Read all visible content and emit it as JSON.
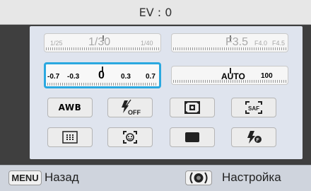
{
  "header": {
    "title": "EV : 0"
  },
  "shutter_scale": {
    "left": "1/25",
    "current": "1/30",
    "right": "1/40"
  },
  "aperture_scale": {
    "current": "F3.5",
    "next1": "F4.0",
    "next2": "F4.5"
  },
  "ev_scale": {
    "values": [
      "-0.7",
      "-0.3",
      "0",
      "0.3",
      "0.7"
    ]
  },
  "iso_scale": {
    "current": "AUTO",
    "next": "100"
  },
  "buttons": {
    "awb": "AWB",
    "flash_off_label": "OFF",
    "smart_af_label": "SAF"
  },
  "footer": {
    "menu_button": "MENU",
    "back_label": "Назад",
    "settings_label": "Настройка"
  },
  "colors": {
    "accent": "#2aa8e0",
    "panel": "#dfe4ee"
  }
}
